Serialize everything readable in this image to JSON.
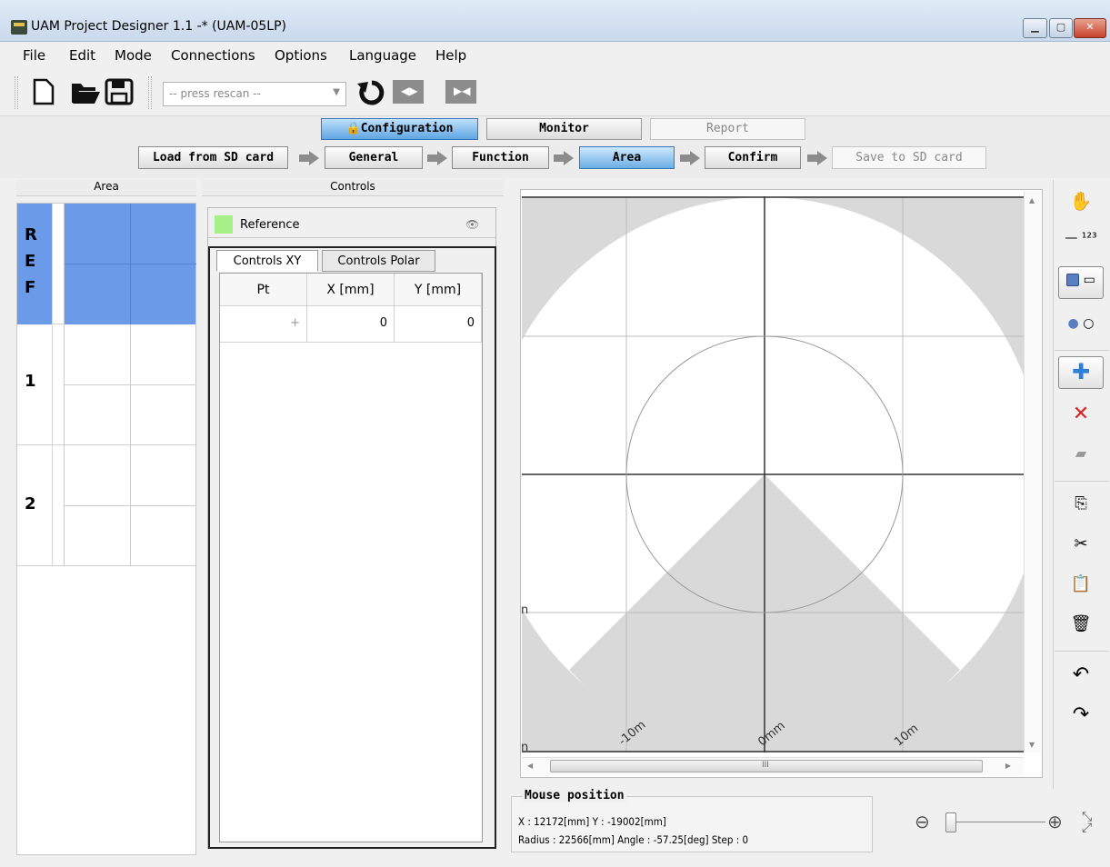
{
  "window": {
    "title": "UAM Project Designer 1.1 -* (UAM-05LP)"
  },
  "menu": [
    "File",
    "Edit",
    "Mode",
    "Connections",
    "Options",
    "Language",
    "Help"
  ],
  "toolbar": {
    "port_select": "-- press rescan --"
  },
  "modes": {
    "configuration": "Configuration",
    "monitor": "Monitor",
    "report": "Report"
  },
  "steps": {
    "load": "Load from SD card",
    "general": "General",
    "function": "Function",
    "area": "Area",
    "confirm": "Confirm",
    "save": "Save to SD card"
  },
  "area_panel": {
    "header": "Area",
    "rows": [
      {
        "label": "R\nE\nF"
      },
      {
        "label": "1"
      },
      {
        "label": "2"
      }
    ]
  },
  "controls": {
    "header": "Controls",
    "reference_label": "Reference",
    "reference_color": "#a6f08a",
    "tabs": [
      "Controls XY",
      "Controls Polar"
    ],
    "columns": [
      "Pt",
      "X [mm]",
      "Y [mm]"
    ],
    "rows": [
      {
        "pt": "+",
        "x": "0",
        "y": "0"
      }
    ]
  },
  "canvas": {
    "axis_labels": [
      "-10m",
      "0mm",
      "10m"
    ],
    "left_labels": [
      "n",
      "n",
      "n"
    ],
    "hscroll_label": "III"
  },
  "mouse_position": {
    "title": "Mouse position",
    "line1": "X : 12172[mm]          Y : -19002[mm]",
    "line2": "Radius : 22566[mm]  Angle : -57.25[deg]  Step : 0"
  },
  "colors": {
    "accent": "#6a9ae8",
    "active_button": "#5fa6e3",
    "sensor_area": "#d9d9d9"
  }
}
